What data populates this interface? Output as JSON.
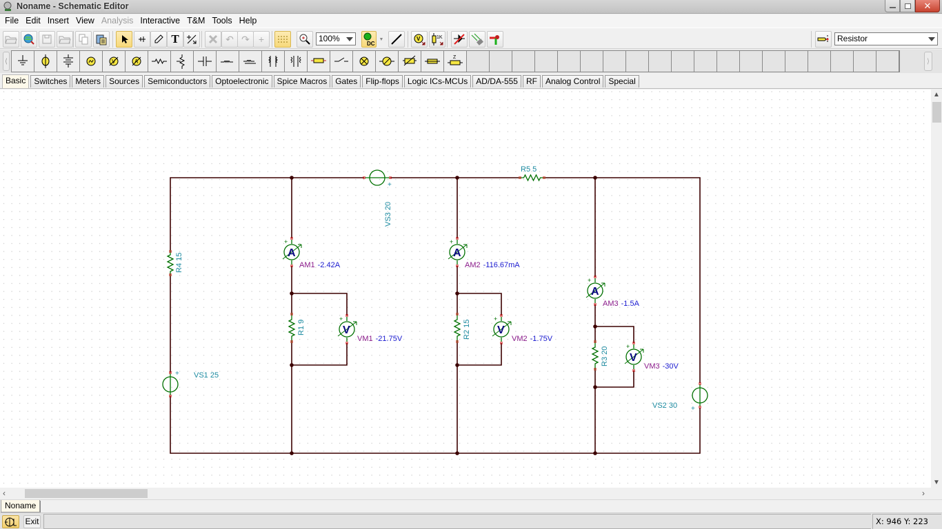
{
  "window": {
    "title": "Noname - Schematic Editor",
    "controls": {
      "minimize": "–",
      "maximize": "❐",
      "close": "✕"
    }
  },
  "menu": [
    {
      "label": "File",
      "enabled": true
    },
    {
      "label": "Edit",
      "enabled": true
    },
    {
      "label": "Insert",
      "enabled": true
    },
    {
      "label": "View",
      "enabled": true
    },
    {
      "label": "Analysis",
      "enabled": false
    },
    {
      "label": "Interactive",
      "enabled": true
    },
    {
      "label": "T&M",
      "enabled": true
    },
    {
      "label": "Tools",
      "enabled": true
    },
    {
      "label": "Help",
      "enabled": true
    }
  ],
  "toolbar": {
    "buttons": [
      {
        "name": "open-icon",
        "glyph": "📂",
        "state": "dim"
      },
      {
        "name": "web-search-icon",
        "glyph": "🌐",
        "state": "normal"
      },
      {
        "name": "save-icon",
        "glyph": "💾",
        "state": "dim"
      },
      {
        "name": "open-recent-icon",
        "glyph": "📂",
        "state": "dim"
      },
      {
        "name": "copy-icon",
        "glyph": "⧉",
        "state": "dim"
      },
      {
        "name": "paste-icon",
        "glyph": "📋",
        "state": "normal"
      },
      {
        "name": "select-arrow-icon",
        "glyph": "➤",
        "state": "active"
      },
      {
        "name": "wire-icon",
        "glyph": "⌖",
        "state": "normal"
      },
      {
        "name": "pen-icon",
        "glyph": "✎",
        "state": "normal"
      },
      {
        "name": "text-icon",
        "glyph": "T",
        "state": "normal"
      },
      {
        "name": "line-tool-icon",
        "glyph": "⟋",
        "state": "normal"
      },
      {
        "name": "delete-icon",
        "glyph": "✕",
        "state": "dim"
      },
      {
        "name": "undo-icon",
        "glyph": "↶",
        "state": "dim"
      },
      {
        "name": "redo-icon",
        "glyph": "↷",
        "state": "dim"
      },
      {
        "name": "junction-icon",
        "glyph": "+",
        "state": "dim"
      },
      {
        "name": "grid-icon",
        "glyph": "⠿",
        "state": "active"
      },
      {
        "name": "zoom-icon",
        "glyph": "🔍",
        "state": "normal"
      }
    ],
    "zoom_level": "100%",
    "analysis_mode": "DC",
    "component_selector": "Resistor"
  },
  "parts": [
    "ground",
    "battery-source",
    "multi-cell-battery",
    "ac-source",
    "voltmeter",
    "ammeter",
    "resistor",
    "potentiometer",
    "capacitor",
    "inductor",
    "coupled-inductor",
    "transformer",
    "ideal-transformer",
    "relay",
    "switch",
    "lamp",
    "motor",
    "thermistor",
    "fuse",
    "impedance"
  ],
  "tabs": [
    {
      "label": "Basic",
      "active": true
    },
    {
      "label": "Switches",
      "active": false
    },
    {
      "label": "Meters",
      "active": false
    },
    {
      "label": "Sources",
      "active": false
    },
    {
      "label": "Semiconductors",
      "active": false
    },
    {
      "label": "Optoelectronic",
      "active": false
    },
    {
      "label": "Spice Macros",
      "active": false
    },
    {
      "label": "Gates",
      "active": false
    },
    {
      "label": "Flip-flops",
      "active": false
    },
    {
      "label": "Logic ICs-MCUs",
      "active": false
    },
    {
      "label": "AD/DA-555",
      "active": false
    },
    {
      "label": "RF",
      "active": false
    },
    {
      "label": "Analog Control",
      "active": false
    },
    {
      "label": "Special",
      "active": false
    }
  ],
  "schematic": {
    "colors": {
      "wire": "#3c0000",
      "component": "#007000",
      "label": "#1c8aa0",
      "meter_name": "#8a1a8a",
      "meter_value": "#1a1ad0",
      "pin": "#d00000"
    },
    "components": {
      "R4": {
        "name": "R4",
        "value": "15"
      },
      "R1": {
        "name": "R1",
        "value": "9"
      },
      "R2": {
        "name": "R2",
        "value": "15"
      },
      "R3": {
        "name": "R3",
        "value": "20"
      },
      "R5": {
        "name": "R5",
        "value": "5"
      },
      "VS1": {
        "name": "VS1",
        "value": "25"
      },
      "VS2": {
        "name": "VS2",
        "value": "30"
      },
      "VS3": {
        "name": "VS3",
        "value": "20"
      }
    },
    "meters": {
      "AM1": {
        "name": "AM1",
        "reading": "-2.42A",
        "symbol": "A"
      },
      "AM2": {
        "name": "AM2",
        "reading": "-116.67mA",
        "symbol": "A"
      },
      "AM3": {
        "name": "AM3",
        "reading": "-1.5A",
        "symbol": "A"
      },
      "VM1": {
        "name": "VM1",
        "reading": "-21.75V",
        "symbol": "V"
      },
      "VM2": {
        "name": "VM2",
        "reading": "-1.75V",
        "symbol": "V"
      },
      "VM3": {
        "name": "VM3",
        "reading": "-30V",
        "symbol": "V"
      }
    },
    "plus_sign": "+"
  },
  "document_tabs": [
    {
      "label": "Noname",
      "active": true
    }
  ],
  "status": {
    "exit_label": "Exit",
    "coordinates": "X: 946  Y: 223"
  }
}
